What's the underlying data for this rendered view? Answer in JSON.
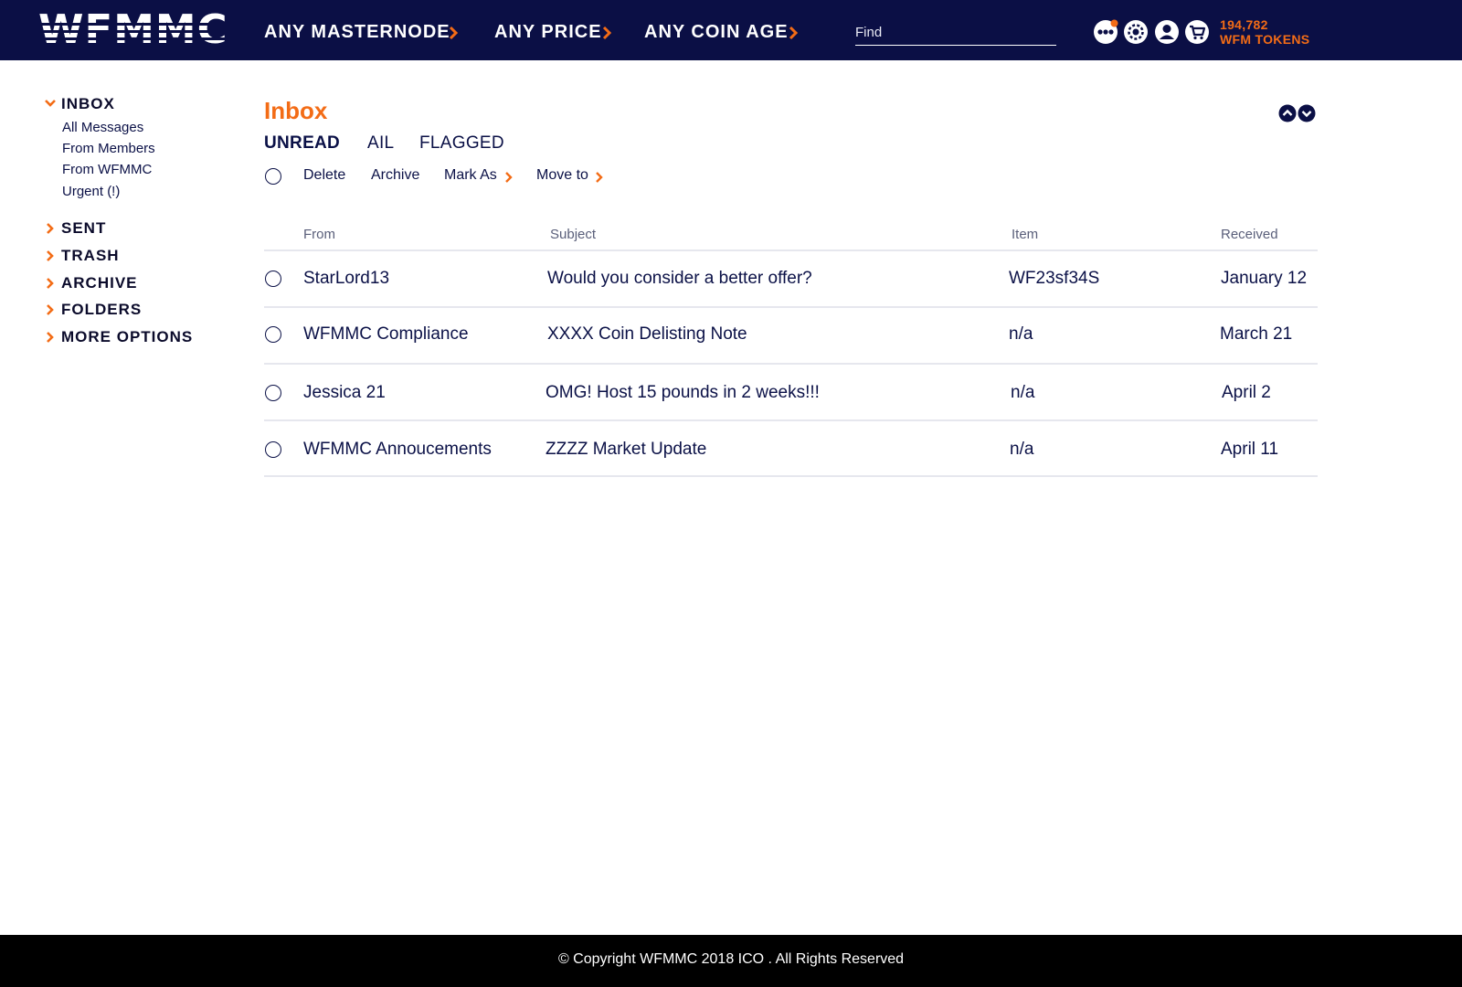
{
  "colors": {
    "header_bg": "#0b0f45",
    "accent": "#f36c16",
    "text": "#0b1147",
    "footer_bg": "#000000"
  },
  "header": {
    "logo": "WFMMC",
    "nav": [
      {
        "label": "ANY MASTERNODE",
        "icon": "chevron-right-icon"
      },
      {
        "label": "ANY PRICE",
        "icon": "chevron-right-icon"
      },
      {
        "label": "ANY COIN AGE",
        "icon": "chevron-right-icon"
      }
    ],
    "search": {
      "placeholder": "Find",
      "value": ""
    },
    "icons": [
      "more-dots-icon",
      "settings-gear-icon",
      "user-account-icon",
      "shopping-cart-icon"
    ],
    "tokens_amount": "194,782",
    "tokens_label": "WFM TOKENS"
  },
  "sidebar": {
    "inbox": {
      "label": "INBOX",
      "expanded": true,
      "items": [
        "All Messages",
        "From Members",
        "From WFMMC",
        "Urgent (!)"
      ]
    },
    "sections": [
      "SENT",
      "TRASH",
      "ARCHIVE",
      "FOLDERS",
      "MORE OPTIONS"
    ]
  },
  "main": {
    "title": "Inbox",
    "tabs": [
      {
        "label": "UNREAD",
        "active": true
      },
      {
        "label": "AIL",
        "active": false
      },
      {
        "label": "FLAGGED",
        "active": false
      }
    ],
    "actions": {
      "delete": "Delete",
      "archive": "Archive",
      "mark_as": "Mark As",
      "move_to": "Move to"
    },
    "columns": {
      "from": "From",
      "subject": "Subject",
      "item": "Item",
      "received": "Received"
    },
    "messages": [
      {
        "from": "StarLord13",
        "subject": "Would you consider a better offer?",
        "item": "WF23sf34S",
        "received": "January 12"
      },
      {
        "from": "WFMMC Compliance",
        "subject": "XXXX Coin Delisting Note",
        "item": "n/a",
        "received": "March 21"
      },
      {
        "from": "Jessica 21",
        "subject": "OMG! Host 15 pounds in 2 weeks!!!",
        "item": "n/a",
        "received": "April 2"
      },
      {
        "from": "WFMMC Annoucements",
        "subject": "ZZZZ Market Update",
        "item": "n/a",
        "received": "April 11"
      }
    ]
  },
  "footer": {
    "text": "© Copyright WFMMC 2018 ICO . All Rights Reserved"
  }
}
